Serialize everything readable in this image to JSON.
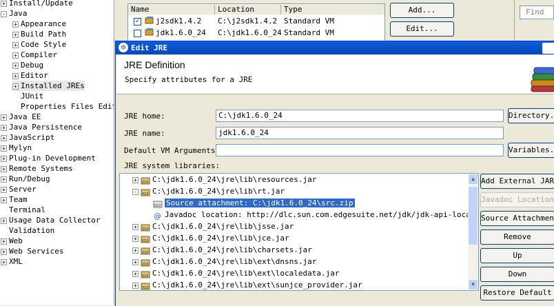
{
  "tree": {
    "items": [
      {
        "label": "Install/Update",
        "twisty": "+",
        "indent": 0
      },
      {
        "label": "Java",
        "twisty": "-",
        "indent": 0
      },
      {
        "label": "Appearance",
        "twisty": "+",
        "indent": 1
      },
      {
        "label": "Build Path",
        "twisty": "+",
        "indent": 1
      },
      {
        "label": "Code Style",
        "twisty": "+",
        "indent": 1
      },
      {
        "label": "Compiler",
        "twisty": "+",
        "indent": 1
      },
      {
        "label": "Debug",
        "twisty": "+",
        "indent": 1
      },
      {
        "label": "Editor",
        "twisty": "+",
        "indent": 1
      },
      {
        "label": "Installed JREs",
        "twisty": "+",
        "indent": 1,
        "selected": true
      },
      {
        "label": "JUnit",
        "twisty": "",
        "indent": 1
      },
      {
        "label": "Properties Files Edit",
        "twisty": "",
        "indent": 1
      },
      {
        "label": "Java EE",
        "twisty": "+",
        "indent": 0
      },
      {
        "label": "Java Persistence",
        "twisty": "+",
        "indent": 0
      },
      {
        "label": "JavaScript",
        "twisty": "+",
        "indent": 0
      },
      {
        "label": "Mylyn",
        "twisty": "+",
        "indent": 0
      },
      {
        "label": "Plug-in Development",
        "twisty": "+",
        "indent": 0
      },
      {
        "label": "Remote Systems",
        "twisty": "+",
        "indent": 0
      },
      {
        "label": "Run/Debug",
        "twisty": "+",
        "indent": 0
      },
      {
        "label": "Server",
        "twisty": "+",
        "indent": 0
      },
      {
        "label": "Team",
        "twisty": "+",
        "indent": 0
      },
      {
        "label": "Terminal",
        "twisty": "",
        "indent": 0
      },
      {
        "label": "Usage Data Collector",
        "twisty": "+",
        "indent": 0
      },
      {
        "label": "Validation",
        "twisty": "",
        "indent": 0
      },
      {
        "label": "Web",
        "twisty": "+",
        "indent": 0
      },
      {
        "label": "Web Services",
        "twisty": "+",
        "indent": 0
      },
      {
        "label": "XML",
        "twisty": "+",
        "indent": 0
      }
    ]
  },
  "installed_jres": {
    "columns": [
      "Name",
      "Location",
      "Type"
    ],
    "rows": [
      {
        "checked": true,
        "name": "j2sdk1.4.2",
        "location": "C:\\j2sdk1.4.2",
        "type": "Standard VM"
      },
      {
        "checked": false,
        "name": "jdk1.6.0_24",
        "location": "C:\\jdk1.6.0_24",
        "type": "Standard VM"
      }
    ],
    "add_label": "Add...",
    "edit_label": "Edit...",
    "find_placeholder": "Find"
  },
  "dialog": {
    "title": "Edit JRE",
    "banner_title": "JRE Definition",
    "banner_desc": "Specify attributes for a JRE",
    "jre_home_label": "JRE home:",
    "jre_home_value": "C:\\jdk1.6.0_24",
    "directory_button": "Directory...",
    "jre_name_label": "JRE name:",
    "jre_name_value": "jdk1.6.0_24",
    "vm_args_label": "Default VM Arguments:",
    "vm_args_value": "",
    "variables_button": "Variables...",
    "libs_label": "JRE system libraries:",
    "libraries": [
      {
        "twisty": "+",
        "indent": 0,
        "icon": "jar",
        "text": "C:\\jdk1.6.0_24\\jre\\lib\\resources.jar"
      },
      {
        "twisty": "-",
        "indent": 0,
        "icon": "jar",
        "text": "C:\\jdk1.6.0_24\\jre\\lib\\rt.jar"
      },
      {
        "twisty": "",
        "indent": 1,
        "icon": "source",
        "text": "Source attachment: C:\\jdk1.6.0_24\\src.zip",
        "selected": true
      },
      {
        "twisty": "",
        "indent": 1,
        "icon": "javadoc",
        "text": "Javadoc location: http://dlc.sun.com.edgesuite.net/jdk/jdk-api-localizat"
      },
      {
        "twisty": "+",
        "indent": 0,
        "icon": "jar",
        "text": "C:\\jdk1.6.0_24\\jre\\lib\\jsse.jar"
      },
      {
        "twisty": "+",
        "indent": 0,
        "icon": "jar",
        "text": "C:\\jdk1.6.0_24\\jre\\lib\\jce.jar"
      },
      {
        "twisty": "+",
        "indent": 0,
        "icon": "jar",
        "text": "C:\\jdk1.6.0_24\\jre\\lib\\charsets.jar"
      },
      {
        "twisty": "+",
        "indent": 0,
        "icon": "jar",
        "text": "C:\\jdk1.6.0_24\\jre\\lib\\ext\\dnsns.jar"
      },
      {
        "twisty": "+",
        "indent": 0,
        "icon": "jar",
        "text": "C:\\jdk1.6.0_24\\jre\\lib\\ext\\localedata.jar"
      },
      {
        "twisty": "+",
        "indent": 0,
        "icon": "jar",
        "text": "C:\\jdk1.6.0_24\\jre\\lib\\ext\\sunjce_provider.jar"
      }
    ],
    "buttons": {
      "add_external_jars": "Add External JARs",
      "javadoc_location": "Javadoc Location...",
      "source_attachment": "Source Attachment...",
      "remove": "Remove",
      "up": "Up",
      "down": "Down",
      "restore_default": "Restore Default"
    }
  },
  "colors": {
    "selection": "#316ac5",
    "titlebar": "#0a5fd8",
    "dialog_bg": "#ece9d8"
  }
}
